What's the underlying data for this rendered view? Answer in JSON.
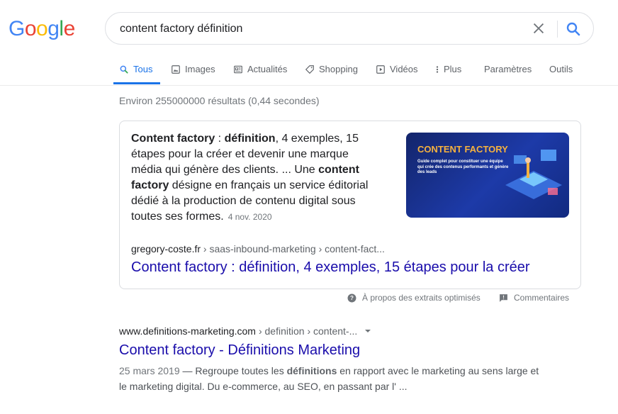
{
  "logo": {
    "letters": [
      "G",
      "o",
      "o",
      "g",
      "l",
      "e"
    ],
    "colors": [
      "#4285f4",
      "#ea4335",
      "#fbbc05",
      "#4285f4",
      "#34a853",
      "#ea4335"
    ]
  },
  "search": {
    "query": "content factory définition"
  },
  "tabs": [
    {
      "label": "Tous",
      "icon": "search-icon"
    },
    {
      "label": "Images",
      "icon": "image-icon"
    },
    {
      "label": "Actualités",
      "icon": "news-icon"
    },
    {
      "label": "Shopping",
      "icon": "tag-icon"
    },
    {
      "label": "Vidéos",
      "icon": "play-icon"
    },
    {
      "label": "Plus",
      "icon": "more-vert-icon"
    },
    {
      "label": "Paramètres"
    },
    {
      "label": "Outils"
    }
  ],
  "stats": "Environ 255000000 résultats (0,44 secondes)",
  "snippet": {
    "parts": [
      {
        "t": "Content factory",
        "b": true
      },
      {
        "t": " : ",
        "b": false
      },
      {
        "t": "définition",
        "b": true
      },
      {
        "t": ", 4 exemples, 15 étapes pour la créer et devenir une marque média qui génère des clients. ... Une ",
        "b": false
      },
      {
        "t": "content factory",
        "b": true
      },
      {
        "t": " désigne en français un service éditorial dédié à la production de contenu digital sous toutes ses formes.",
        "b": false
      }
    ],
    "date": "4 nov. 2020",
    "thumb_title": "CONTENT FACTORY",
    "thumb_sub": "Guide complet pour constituer une équipe qui crée des contenus performants et génère des leads",
    "domain": "gregory-coste.fr",
    "path": " › saas-inbound-marketing › content-fact...",
    "title": "Content factory : définition, 4 exemples, 15 étapes pour la créer",
    "about": "À propos des extraits optimisés",
    "feedback": "Commentaires"
  },
  "result": {
    "domain": "www.definitions-marketing.com",
    "path": " › definition › content-...",
    "title": "Content factory - Définitions Marketing",
    "date": "25 mars 2019",
    "desc_parts": [
      {
        "t": " — Regroupe toutes les ",
        "b": false
      },
      {
        "t": "définitions",
        "b": true
      },
      {
        "t": " en rapport avec le marketing au sens large et le marketing digital. Du e-commerce, au SEO, en passant par l' ...",
        "b": false
      }
    ]
  }
}
